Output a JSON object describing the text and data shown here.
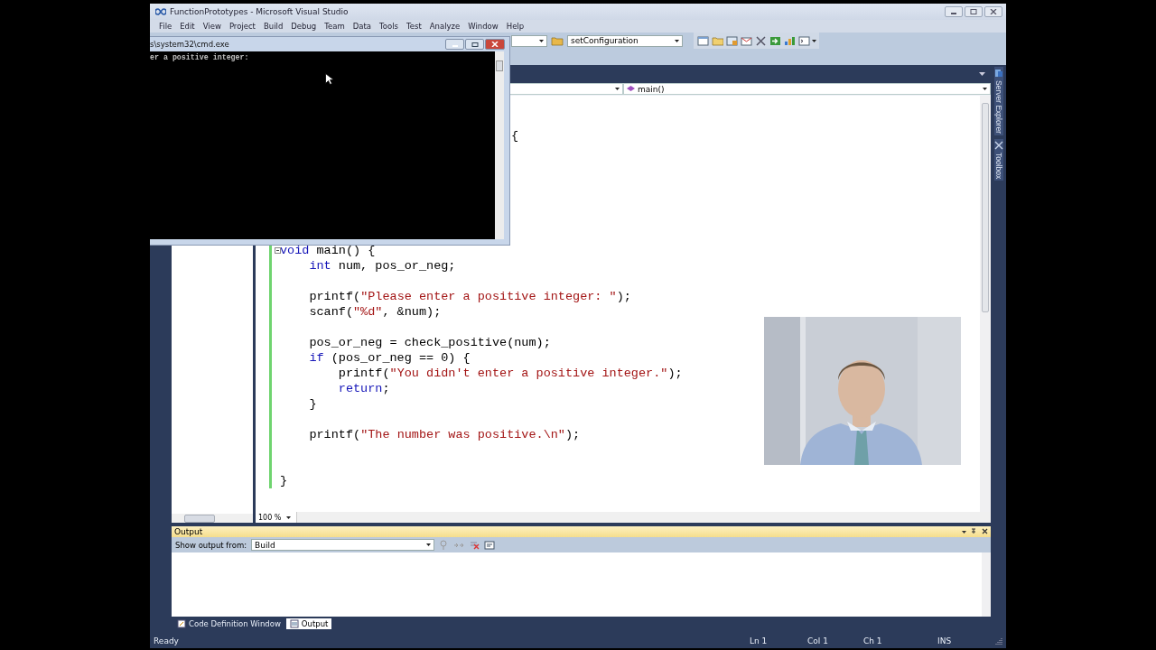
{
  "window": {
    "title": "FunctionPrototypes - Microsoft Visual Studio"
  },
  "menu": [
    "File",
    "Edit",
    "View",
    "Project",
    "Build",
    "Debug",
    "Team",
    "Data",
    "Tools",
    "Test",
    "Analyze",
    "Window",
    "Help"
  ],
  "toolbar": {
    "config_dropdown": "setConfiguration"
  },
  "navigation_bar": {
    "member_dropdown": "main()"
  },
  "editor": {
    "fragment_above": "{",
    "zoom": "100 %",
    "lines": [
      {
        "kind": "code",
        "tokens": [
          {
            "kind": "keyword",
            "text": "void"
          },
          {
            "kind": "plain",
            "text": " main() {"
          }
        ]
      },
      {
        "kind": "code",
        "tokens": [
          {
            "kind": "keyword",
            "text": "    int"
          },
          {
            "kind": "plain",
            "text": " num, pos_or_neg;"
          }
        ]
      },
      {
        "kind": "blank"
      },
      {
        "kind": "code",
        "tokens": [
          {
            "kind": "plain",
            "text": "    printf("
          },
          {
            "kind": "string",
            "text": "\"Please enter a positive integer: \""
          },
          {
            "kind": "plain",
            "text": ");"
          }
        ]
      },
      {
        "kind": "code",
        "tokens": [
          {
            "kind": "plain",
            "text": "    scanf("
          },
          {
            "kind": "string",
            "text": "\"%d\""
          },
          {
            "kind": "plain",
            "text": ", &num);"
          }
        ]
      },
      {
        "kind": "blank"
      },
      {
        "kind": "code",
        "tokens": [
          {
            "kind": "plain",
            "text": "    pos_or_neg = check_positive(num);"
          }
        ]
      },
      {
        "kind": "code",
        "tokens": [
          {
            "kind": "keyword",
            "text": "    if"
          },
          {
            "kind": "plain",
            "text": " (pos_or_neg == 0) {"
          }
        ]
      },
      {
        "kind": "code",
        "tokens": [
          {
            "kind": "plain",
            "text": "        printf("
          },
          {
            "kind": "string",
            "text": "\"You didn't enter a positive integer.\""
          },
          {
            "kind": "plain",
            "text": ");"
          }
        ]
      },
      {
        "kind": "code",
        "tokens": [
          {
            "kind": "keyword",
            "text": "        return"
          },
          {
            "kind": "plain",
            "text": ";"
          }
        ]
      },
      {
        "kind": "code",
        "tokens": [
          {
            "kind": "plain",
            "text": "    }"
          }
        ]
      },
      {
        "kind": "blank"
      },
      {
        "kind": "code",
        "tokens": [
          {
            "kind": "plain",
            "text": "    printf("
          },
          {
            "kind": "string",
            "text": "\"The number was positive.\\n\""
          },
          {
            "kind": "plain",
            "text": ");"
          }
        ]
      },
      {
        "kind": "blank"
      },
      {
        "kind": "blank"
      },
      {
        "kind": "code",
        "tokens": [
          {
            "kind": "plain",
            "text": "}"
          }
        ]
      }
    ]
  },
  "side_tabs": [
    "Server Explorer",
    "Toolbox"
  ],
  "output_panel": {
    "title": "Output",
    "source_label": "Show output from:",
    "source": "Build"
  },
  "bottom_tabs": [
    {
      "label": "Code Definition Window",
      "selected": false
    },
    {
      "label": "Output",
      "selected": true
    }
  ],
  "status_bar": {
    "message": "Ready",
    "line": "Ln 1",
    "column": "Col 1",
    "character": "Ch 1",
    "mode": "INS"
  },
  "console_window": {
    "title": "s\\system32\\cmd.exe",
    "output": "er a positive integer:"
  },
  "webcam": {
    "kind": "picture"
  }
}
